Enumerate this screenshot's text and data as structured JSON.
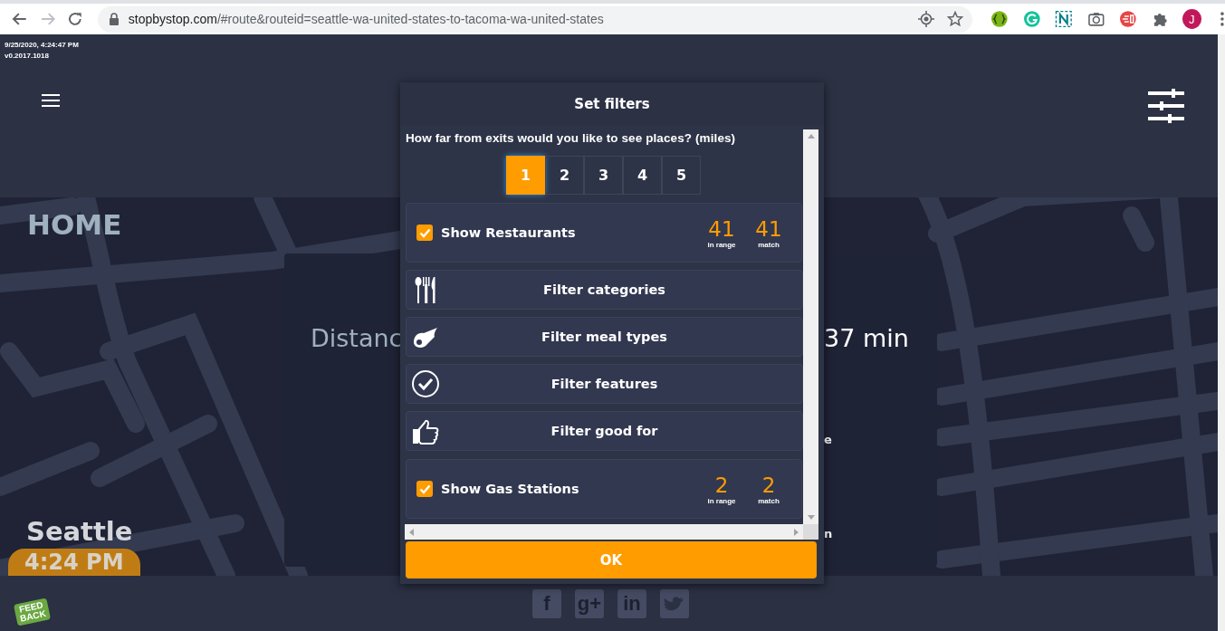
{
  "browser": {
    "url_host": "stopbystop.com",
    "url_path": "/#route&routeid=seattle-wa-united-states-to-tacoma-wa-united-states",
    "profile_initial": "J"
  },
  "header": {
    "timestamp": "9/25/2020, 4:24:47 PM",
    "version": "v0.2017.1018"
  },
  "home": {
    "title": "HOME"
  },
  "trip": {
    "distance": "Distanc",
    "duration": "37 min",
    "fragments": [
      "e",
      "n"
    ]
  },
  "origin": {
    "city": "Seattle",
    "time": "4:24 PM"
  },
  "footer": {
    "feedback": [
      "FEED",
      "BACK"
    ],
    "social": [
      "f",
      "g+",
      "in"
    ]
  },
  "modal": {
    "title": "Set filters",
    "question": "How far from exits would you like to see places? (miles)",
    "distances": [
      {
        "label": "1",
        "selected": true
      },
      {
        "label": "2",
        "selected": false
      },
      {
        "label": "3",
        "selected": false
      },
      {
        "label": "4",
        "selected": false
      },
      {
        "label": "5",
        "selected": false
      }
    ],
    "sections": [
      {
        "kind": "toggle",
        "label": "Show Restaurants",
        "checked": true,
        "in_range": "41",
        "in_range_label": "in range",
        "match": "41",
        "match_label": "match"
      },
      {
        "kind": "filter",
        "label": "Filter categories"
      },
      {
        "kind": "filter",
        "label": "Filter meal types"
      },
      {
        "kind": "filter",
        "label": "Filter features"
      },
      {
        "kind": "filter",
        "label": "Filter good for"
      },
      {
        "kind": "toggle",
        "label": "Show Gas Stations",
        "checked": true,
        "in_range": "2",
        "in_range_label": "in range",
        "match": "2",
        "match_label": "match"
      }
    ],
    "ok": "OK"
  }
}
